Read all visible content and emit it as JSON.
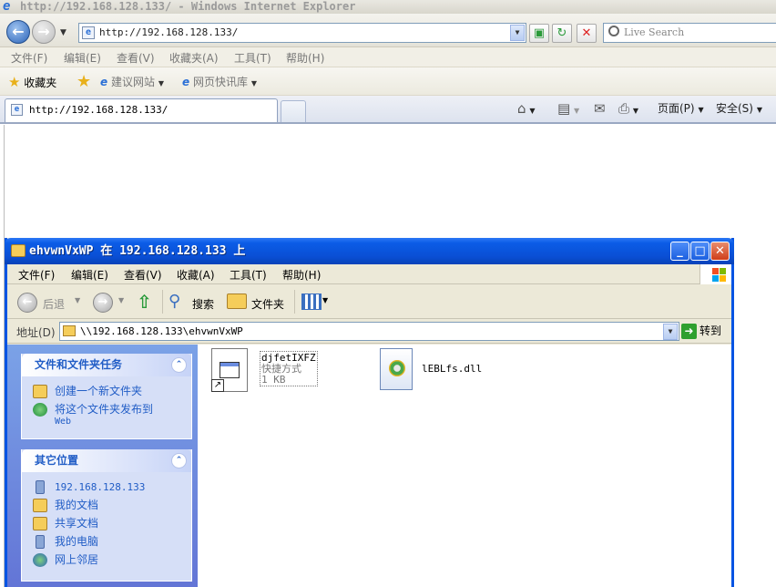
{
  "ie": {
    "title": "http://192.168.128.133/ - Windows Internet Explorer",
    "address": "http://192.168.128.133/",
    "search_placeholder": "Live Search",
    "menu": [
      "文件(F)",
      "编辑(E)",
      "查看(V)",
      "收藏夹(A)",
      "工具(T)",
      "帮助(H)"
    ],
    "favorites": {
      "favorites_label": "收藏夹",
      "suggested_sites": "建议网站",
      "web_slice": "网页快讯库"
    },
    "tab_title": "http://192.168.128.133/",
    "commands": {
      "page": "页面(P)",
      "safety": "安全(S)"
    }
  },
  "explorer": {
    "title": "ehvwnVxWP 在 192.168.128.133 上",
    "menu": [
      "文件(F)",
      "编辑(E)",
      "查看(V)",
      "收藏(A)",
      "工具(T)",
      "帮助(H)"
    ],
    "toolbar": {
      "back": "后退",
      "search": "搜索",
      "folders": "文件夹"
    },
    "address_label": "地址(D)",
    "address": "\\\\192.168.128.133\\ehvwnVxWP",
    "go": "转到",
    "tasks_panel": {
      "title": "文件和文件夹任务",
      "items": [
        {
          "label": "创建一个新文件夹"
        },
        {
          "label": "将这个文件夹发布到",
          "sub": "Web"
        }
      ]
    },
    "places_panel": {
      "title": "其它位置",
      "items": [
        "192.168.128.133",
        "我的文档",
        "共享文档",
        "我的电脑",
        "网上邻居"
      ]
    },
    "files": [
      {
        "name": "djfetIXFZ",
        "type": "快捷方式",
        "size": "1 KB"
      },
      {
        "name": "lEBLfs.dll"
      }
    ]
  }
}
